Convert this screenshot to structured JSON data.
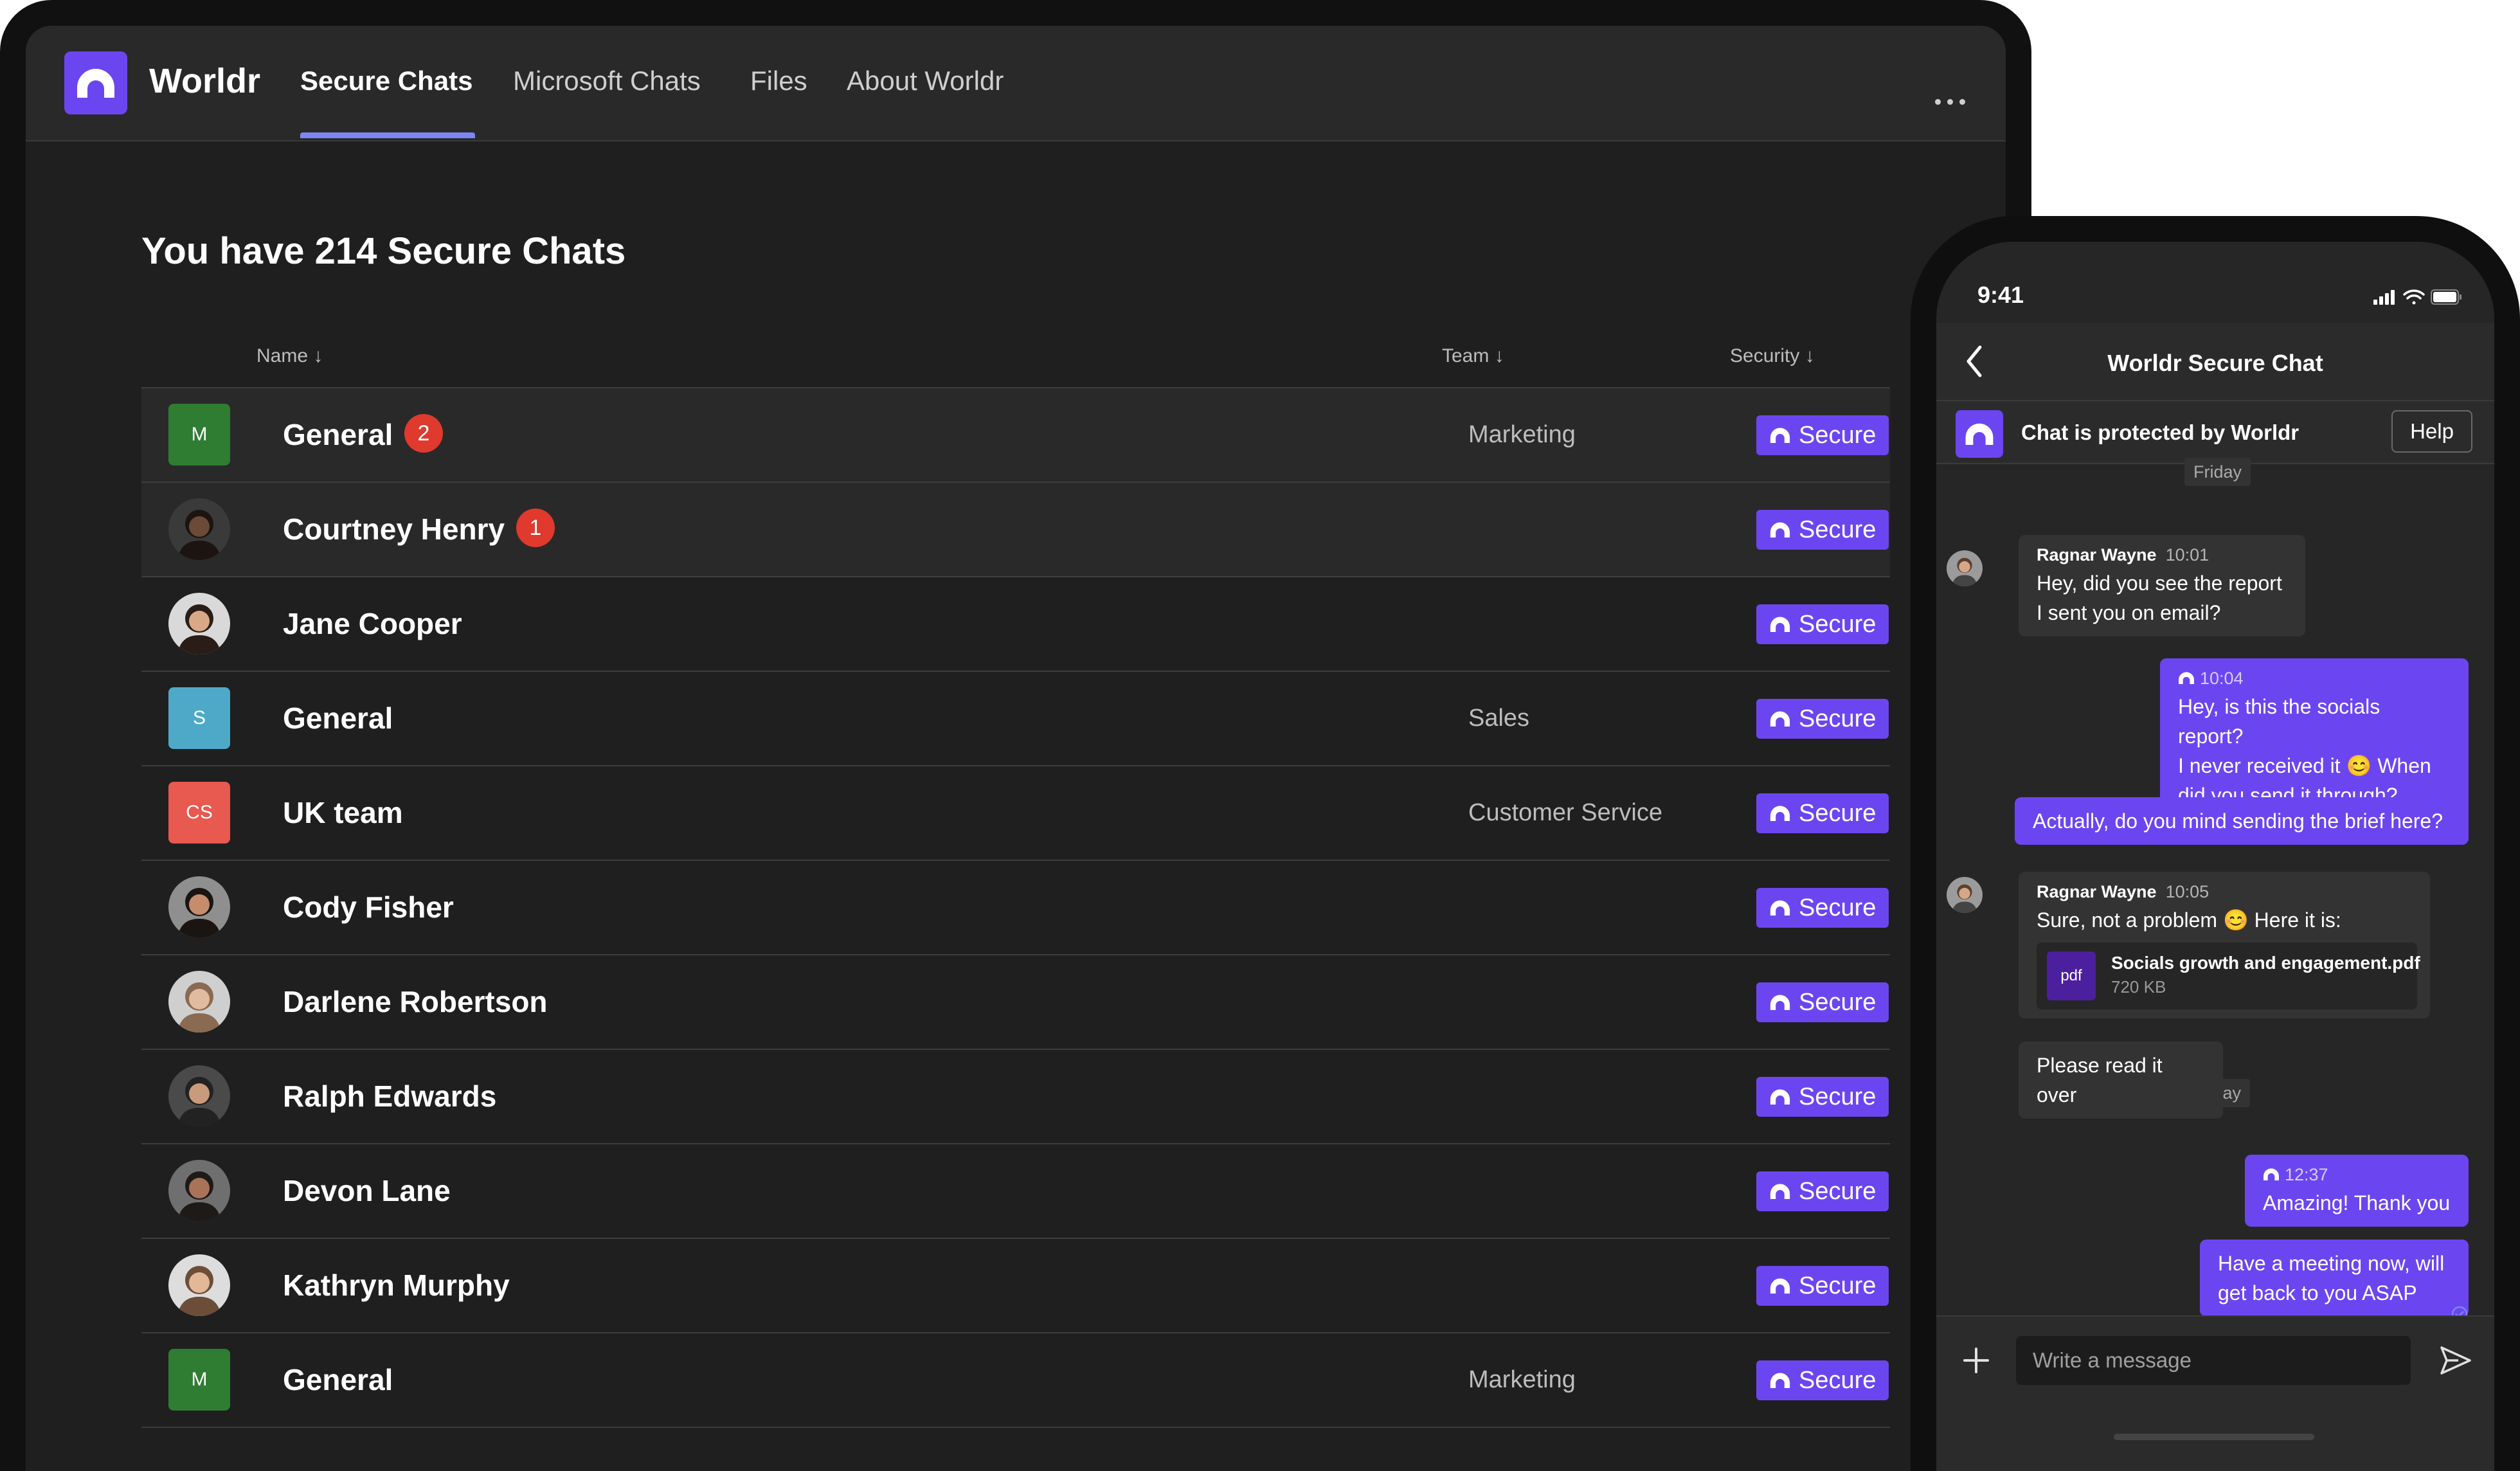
{
  "app": {
    "name": "Worldr",
    "tabs": [
      "Secure Chats",
      "Microsoft Chats",
      "Files",
      "About Worldr"
    ],
    "active_tab": "Secure Chats",
    "more_label": "More options"
  },
  "main": {
    "heading": "You have 214 Secure Chats",
    "columns": {
      "name": "Name ↓",
      "team": "Team ↓",
      "security": "Security ↓"
    },
    "rows": [
      {
        "avatar_type": "initials",
        "initials": "M",
        "avatar_color": "#2e7d32",
        "name": "General",
        "unread": "2",
        "team": "Marketing",
        "security": "Secure"
      },
      {
        "avatar_type": "photo",
        "name": "Courtney Henry",
        "unread": "1",
        "team": "",
        "security": "Secure"
      },
      {
        "avatar_type": "photo",
        "name": "Jane Cooper",
        "unread": "",
        "team": "",
        "security": "Secure"
      },
      {
        "avatar_type": "initials",
        "initials": "S",
        "avatar_color": "#4ea9c8",
        "name": "General",
        "unread": "",
        "team": "Sales",
        "security": "Secure"
      },
      {
        "avatar_type": "initials",
        "initials": "CS",
        "avatar_color": "#e8594f",
        "name": "UK team",
        "unread": "",
        "team": "Customer Service",
        "security": "Secure"
      },
      {
        "avatar_type": "photo",
        "name": "Cody Fisher",
        "unread": "",
        "team": "",
        "security": "Secure"
      },
      {
        "avatar_type": "photo",
        "name": "Darlene Robertson",
        "unread": "",
        "team": "",
        "security": "Secure"
      },
      {
        "avatar_type": "photo",
        "name": "Ralph Edwards",
        "unread": "",
        "team": "",
        "security": "Secure"
      },
      {
        "avatar_type": "photo",
        "name": "Devon Lane",
        "unread": "",
        "team": "",
        "security": "Secure"
      },
      {
        "avatar_type": "photo",
        "name": "Kathryn Murphy",
        "unread": "",
        "team": "",
        "security": "Secure"
      },
      {
        "avatar_type": "initials",
        "initials": "M",
        "avatar_color": "#2e7d32",
        "name": "General",
        "unread": "",
        "team": "Marketing",
        "security": "Secure"
      }
    ]
  },
  "phone": {
    "status_time": "9:41",
    "title": "Worldr Secure Chat",
    "protect_text": "Chat is protected by Worldr",
    "help_label": "Help",
    "day_labels": [
      "Friday",
      "Today"
    ],
    "messages": [
      {
        "dir": "in",
        "author": "Ragnar Wayne",
        "time": "10:01",
        "lines": [
          "Hey, did you see the report",
          "I sent you on email?"
        ]
      },
      {
        "dir": "out",
        "time": "10:04",
        "lines": [
          "Hey, is this the socials report?",
          "I never received it 😊 When",
          "did you send it through?"
        ]
      },
      {
        "dir": "out",
        "time": "",
        "lines": [
          "Actually, do you mind sending the brief here?"
        ]
      },
      {
        "dir": "in",
        "author": "Ragnar Wayne",
        "time": "10:05",
        "lines": [
          "Sure, not a problem 😊 Here it is:"
        ],
        "file": {
          "icon": "pdf",
          "name": "Socials growth and engagement.pdf",
          "size": "720 KB"
        }
      },
      {
        "dir": "in",
        "time": "",
        "lines": [
          "Please read it over"
        ]
      },
      {
        "dir": "out",
        "time": "12:37",
        "lines": [
          "Amazing! Thank you"
        ]
      },
      {
        "dir": "out",
        "time": "",
        "lines": [
          "Have a meeting now, will",
          "get back to you ASAP"
        ]
      }
    ],
    "composer_placeholder": "Write a message"
  },
  "colors": {
    "accent": "#6b46f0",
    "badge": "#e0392e",
    "tab_underline": "#7f85f5"
  },
  "icons": [
    "worldr-logo-icon",
    "more-icon",
    "sort-arrow-icon",
    "lock-shield-icon",
    "back-chevron-icon",
    "signal-icon",
    "wifi-icon",
    "battery-icon",
    "plus-icon",
    "send-icon",
    "read-receipt-icon",
    "pdf-icon"
  ]
}
